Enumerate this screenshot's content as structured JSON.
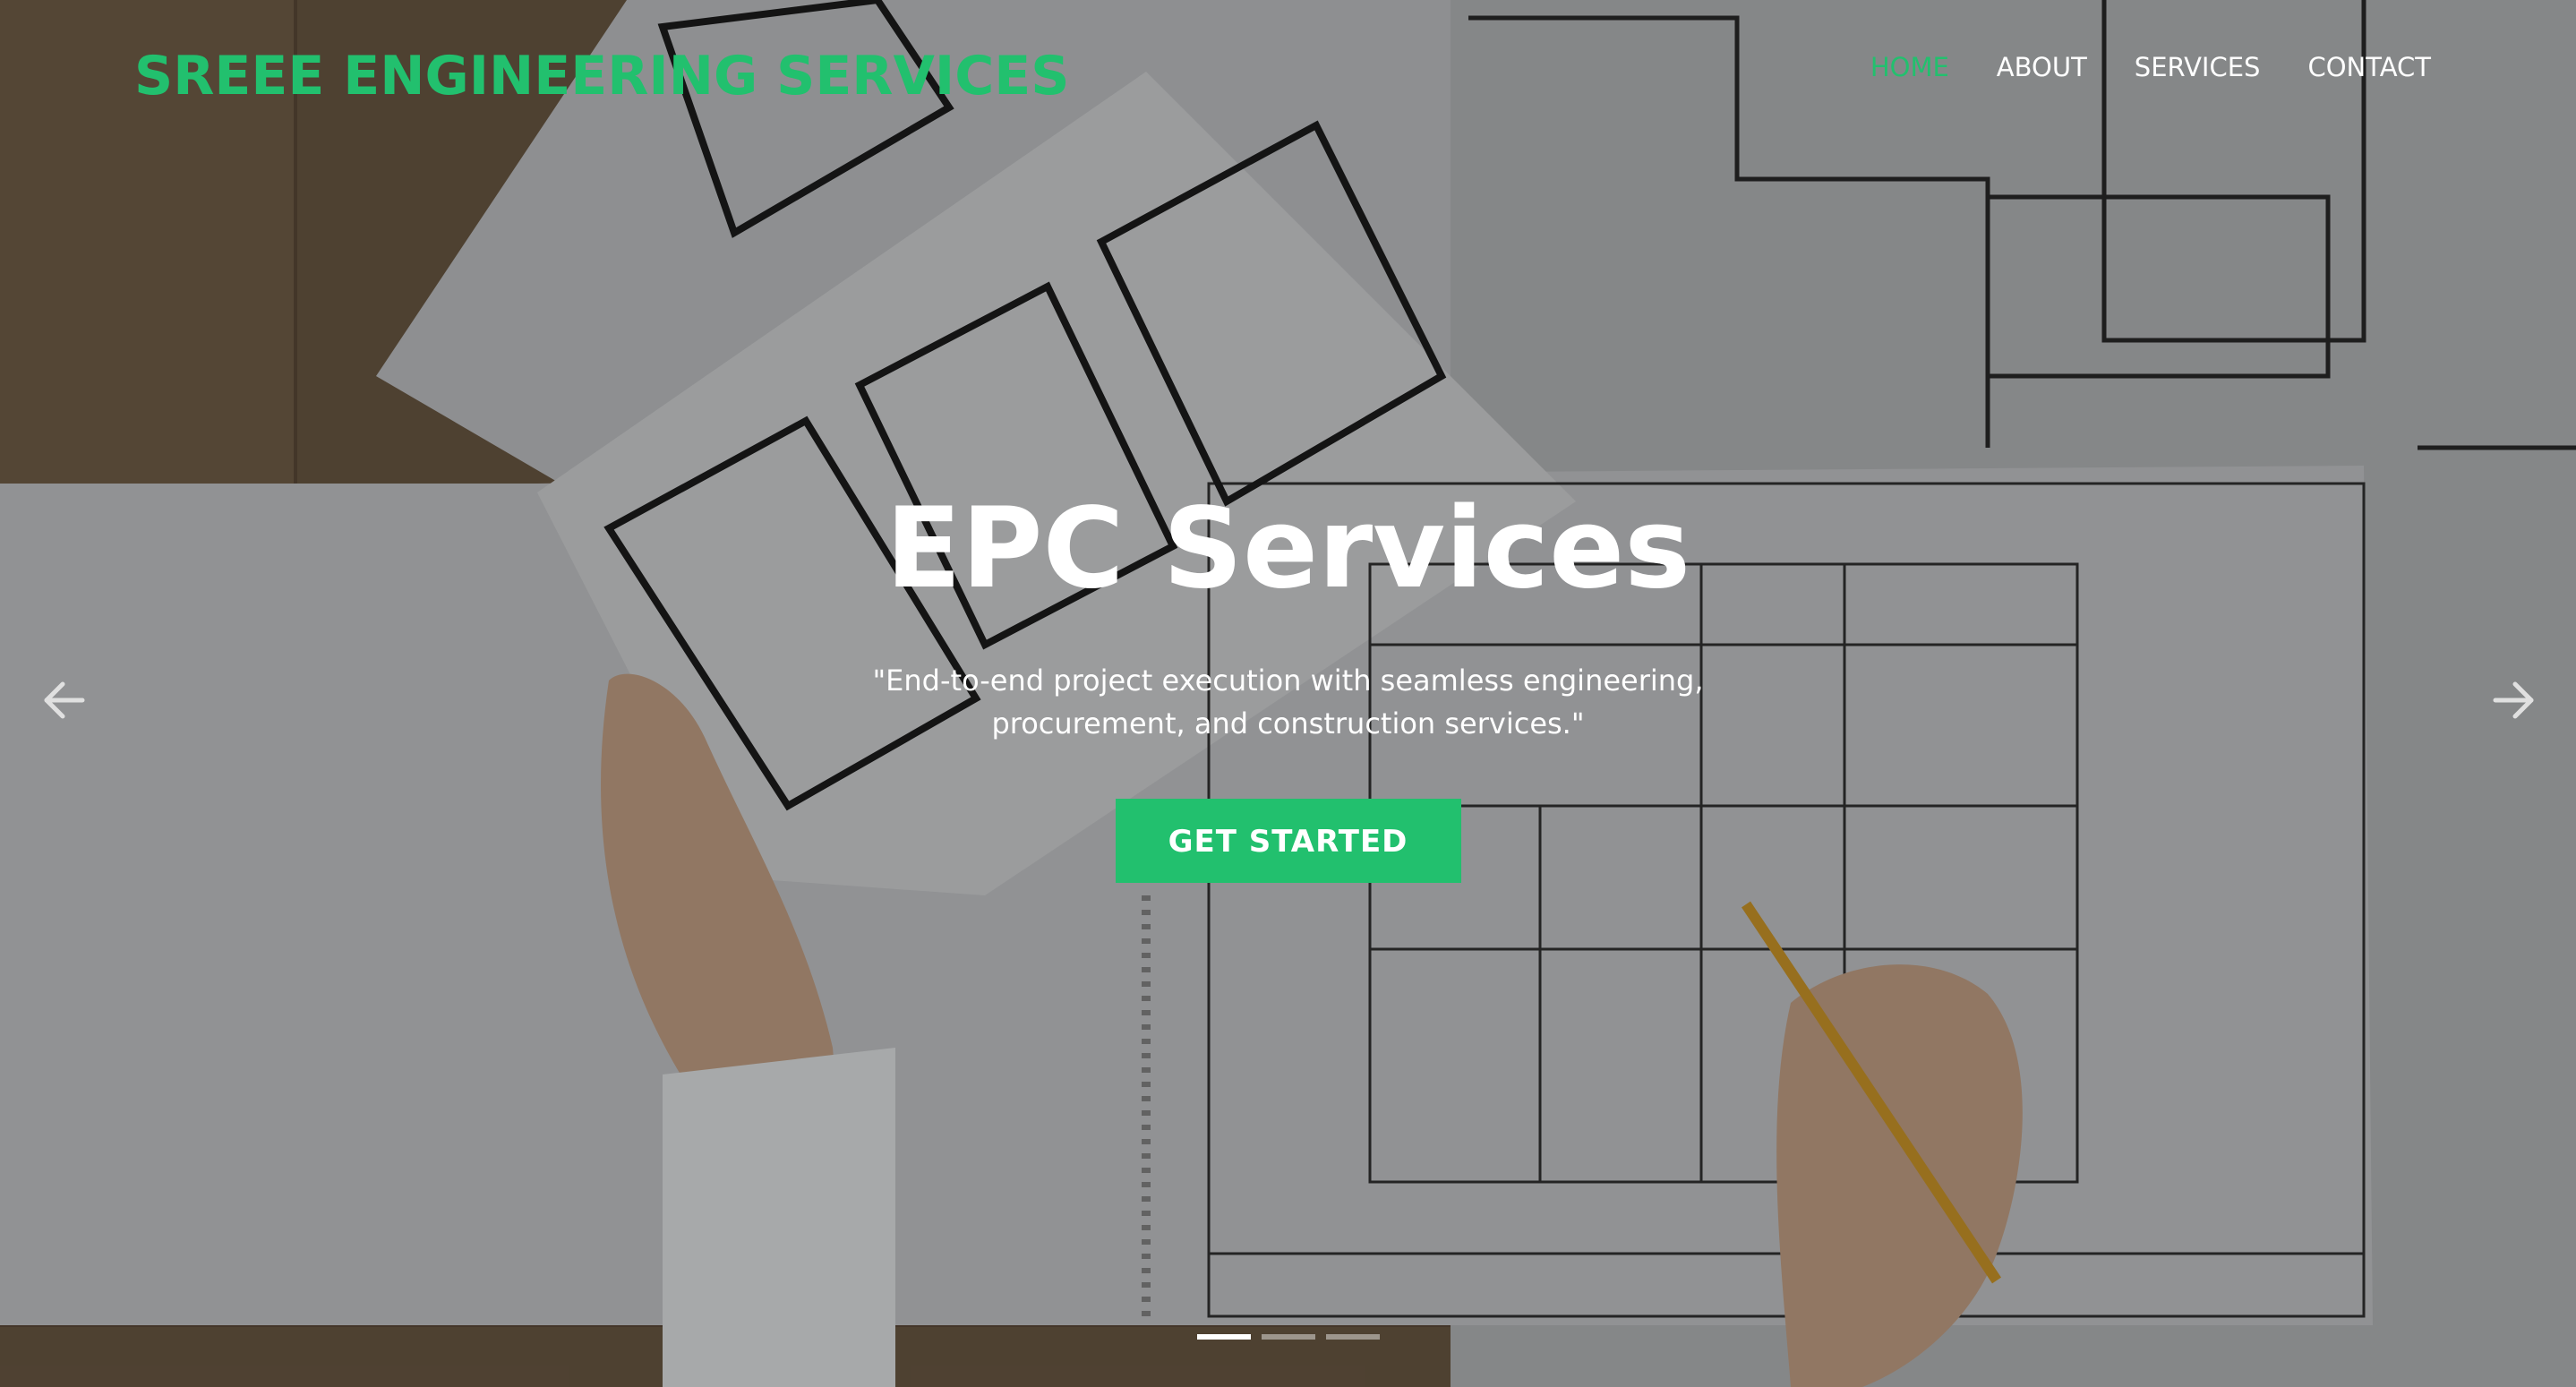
{
  "brand": {
    "name": "SREEE ENGINEERING SERVICES"
  },
  "nav": {
    "items": [
      {
        "label": "HOME",
        "active": true
      },
      {
        "label": "ABOUT",
        "active": false
      },
      {
        "label": "SERVICES",
        "active": false
      },
      {
        "label": "CONTACT",
        "active": false
      }
    ]
  },
  "hero": {
    "headline": "EPC Services",
    "subtitle": "\"End-to-end project execution with seamless engineering, procurement, and construction services.\"",
    "cta_label": "GET STARTED",
    "background": "blueprint-drafting-photo"
  },
  "carousel": {
    "prev_icon": "arrow-left-icon",
    "next_icon": "arrow-right-icon",
    "slide_count": 3,
    "active_slide": 1
  },
  "colors": {
    "accent": "#22c06e",
    "text": "#ffffff"
  }
}
